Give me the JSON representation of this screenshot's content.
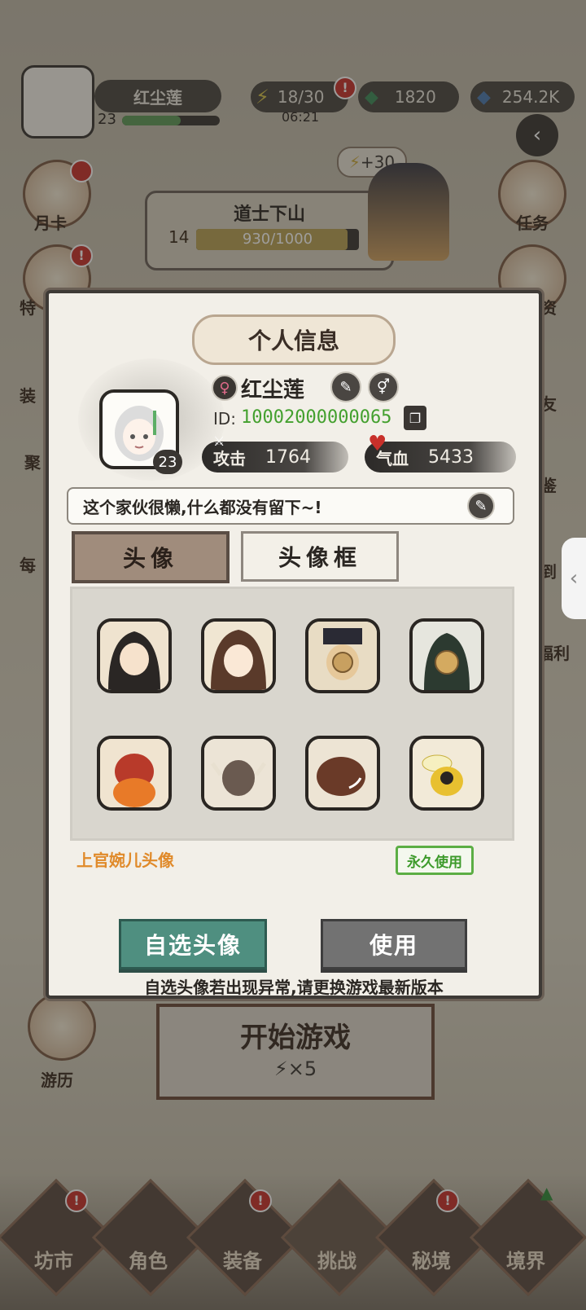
{
  "hud": {
    "player_name": "红尘莲",
    "player_level": "23",
    "stamina": "18/30",
    "stamina_timer": "06:21",
    "jade": "1820",
    "crystals": "254.2K",
    "chapter_title": "道士下山",
    "chapter_level": "14",
    "chapter_progress": "930/1000",
    "chapter_progress_fraction": 0.93,
    "bonus": "+30",
    "start_game": "开始游戏",
    "start_cost": "×5"
  },
  "side_left": [
    {
      "label": "月卡"
    },
    {
      "label": "特"
    },
    {
      "label": "装"
    },
    {
      "label": "聚"
    },
    {
      "label": "每"
    },
    {
      "label": "游历"
    }
  ],
  "side_right": [
    {
      "label": "任务"
    },
    {
      "label": "资"
    },
    {
      "label": "友"
    },
    {
      "label": "鉴"
    },
    {
      "label": "到"
    },
    {
      "label": "福利"
    }
  ],
  "bottom_nav": [
    {
      "label": "坊市"
    },
    {
      "label": "角色"
    },
    {
      "label": "装备"
    },
    {
      "label": "挑战"
    },
    {
      "label": "秘境"
    },
    {
      "label": "境界"
    }
  ],
  "profile": {
    "title": "个人信息",
    "name": "红尘莲",
    "gender_symbol": "♀",
    "level": "23",
    "id_label": "ID:",
    "id_value": "10002000000065",
    "attack_label": "攻击",
    "attack_value": "1764",
    "hp_label": "气血",
    "hp_value": "5433",
    "bio": "这个家伙很懒,什么都没有留下~!",
    "tab_avatar": "头像",
    "tab_frame": "头像框",
    "selected_avatar_name": "上官婉儿头像",
    "permanent_badge": "永久使用",
    "btn_custom": "自选头像",
    "btn_use": "使用",
    "notice": "自选头像若出现异常,请更换游戏最新版本"
  },
  "colors": {
    "id_green": "#43a02e",
    "selected_orange": "#e08a2a",
    "custom_button_teal": "#4f8f80",
    "use_button_gray": "#727272"
  }
}
